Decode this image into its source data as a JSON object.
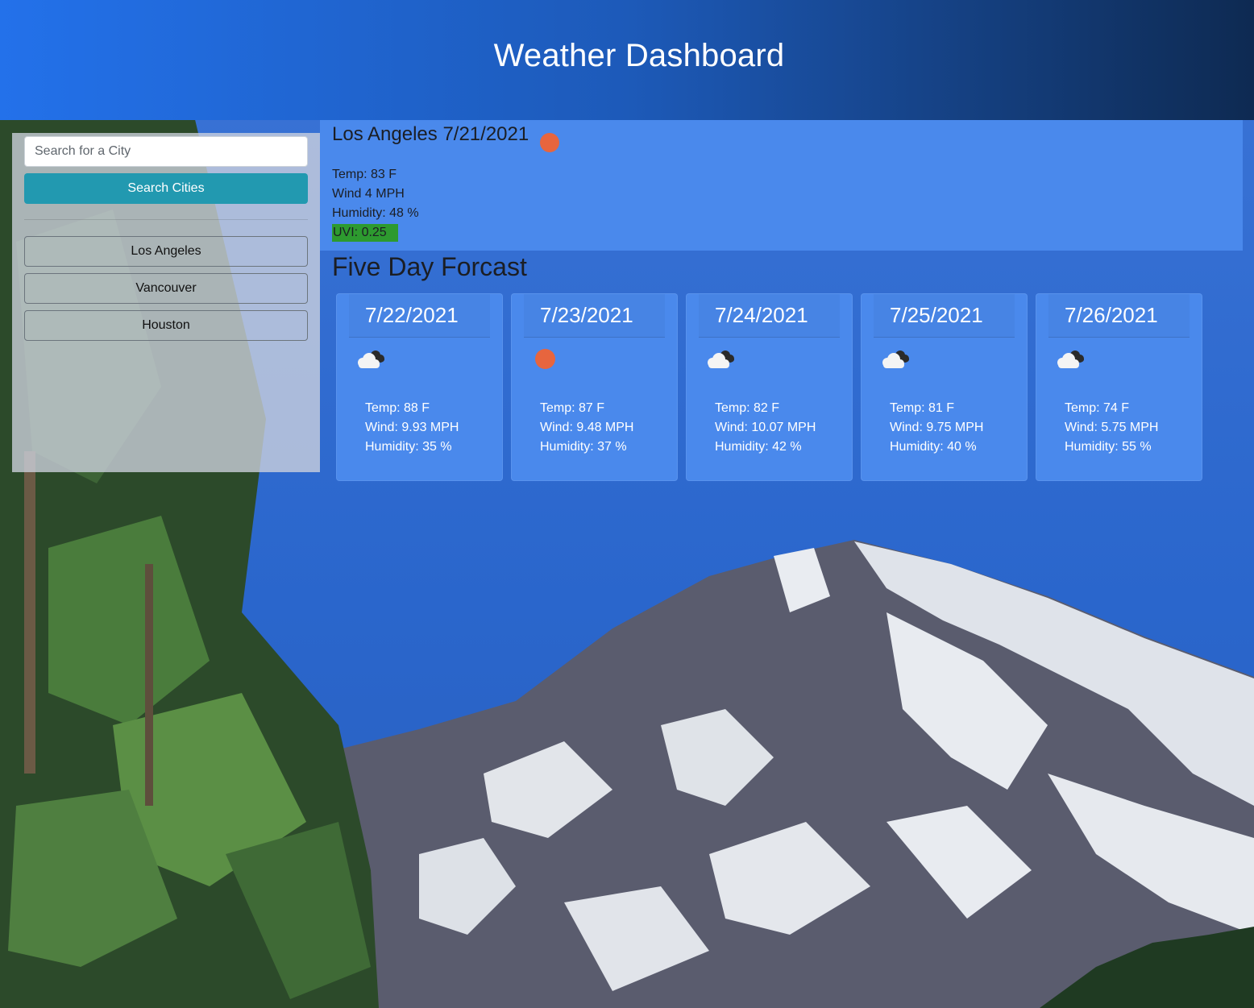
{
  "header": {
    "title": "Weather Dashboard"
  },
  "sidebar": {
    "search_placeholder": "Search for a City",
    "search_button": "Search Cities",
    "history": [
      "Los Angeles",
      "Vancouver",
      "Houston"
    ]
  },
  "current": {
    "title": "Los Angeles 7/21/2021",
    "icon": "sun-icon",
    "temp": "Temp: 83 F",
    "wind": "Wind 4 MPH",
    "humidity": "Humidity: 48 %",
    "uvi": "UVI: 0.25",
    "uvi_color": "#2d9a2f"
  },
  "forecast": {
    "title": "Five Day Forcast",
    "days": [
      {
        "date": "7/22/2021",
        "icon": "cloud-icon",
        "temp": "Temp: 88 F",
        "wind": "Wind: 9.93 MPH",
        "humidity": "Humidity: 35 %"
      },
      {
        "date": "7/23/2021",
        "icon": "sun-icon",
        "temp": "Temp: 87 F",
        "wind": "Wind: 9.48 MPH",
        "humidity": "Humidity: 37 %"
      },
      {
        "date": "7/24/2021",
        "icon": "cloud-icon",
        "temp": "Temp: 82 F",
        "wind": "Wind: 10.07 MPH",
        "humidity": "Humidity: 42 %"
      },
      {
        "date": "7/25/2021",
        "icon": "cloud-icon",
        "temp": "Temp: 81 F",
        "wind": "Wind: 9.75 MPH",
        "humidity": "Humidity: 40 %"
      },
      {
        "date": "7/26/2021",
        "icon": "cloud-icon",
        "temp": "Temp: 74 F",
        "wind": "Wind: 5.75 MPH",
        "humidity": "Humidity: 55 %"
      }
    ]
  }
}
